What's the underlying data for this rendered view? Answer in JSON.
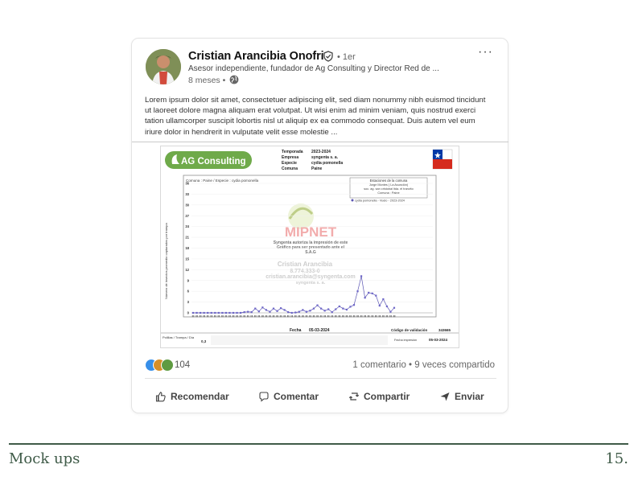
{
  "post": {
    "author_name": "Cristian Arancibia Onofri",
    "connection_degree": "• 1er",
    "headline": "Asesor independiente, fundador de Ag Consulting y Director Red de ...",
    "time": "8 meses •",
    "more_label": "···",
    "text": "Lorem ipsum dolor sit amet, consectetuer adipiscing elit, sed diam nonummy nibh euismod tincidunt ut laoreet dolore magna aliquam erat volutpat. Ut wisi enim ad minim veniam, quis nostrud exerci tation ullamcorper suscipit lobortis nisl ut aliquip ex ea commodo consequat. Duis autem vel eum iriure dolor in hendrerit in vulputate velit esse molestie ...",
    "reactions_count": "104",
    "stats": "1 comentario • 9 veces compartido",
    "actions": {
      "recommend": "Recomendar",
      "comment": "Comentar",
      "share": "Compartir",
      "send": "Enviar"
    }
  },
  "image": {
    "logo": "AG Consulting",
    "meta": {
      "season_label": "Temporada",
      "season": "2023-2024",
      "company_label": "Empresa",
      "company": "syngenta s. a.",
      "species_label": "Especie",
      "species": "cydia pomonella",
      "commune_label": "Comuna",
      "commune": "Paine"
    },
    "chart_subtitle": "Comuna : Paine / Especie : cydia pomonella",
    "legend_title": "Estaciones de la comuna",
    "legend_lines": [
      "Jorge Montes ( La Asunción)",
      "soc. ag. san cristobal ltda. el tranvito",
      "Comuna : Paine"
    ],
    "legend_series": "cydia pomonella - Vuelo - 2023-2024",
    "watermark_brand": "MIPNET",
    "watermark_lines": [
      "Syngenta autoriza la impresión de este",
      "Gráfico para ser presentado ante el",
      "S.A.G"
    ],
    "watermark_person": [
      "Cristian Arancibia",
      "8.774.333-0",
      "cristian.arancibia@syngenta.com",
      "syngenta s. a."
    ],
    "fecha_label": "Fecha",
    "fecha": "05-03-2024",
    "validation_label": "Código de validación",
    "validation_code": "343665",
    "print_label": "Fecha impresión",
    "print_date": "05-03-2024",
    "bottom_left": "Polillas / Trampa / Día",
    "bottom_left_value": "0,3"
  },
  "chart_data": {
    "type": "line",
    "ylabel": "Número de insectos promedio capturados por trampa",
    "ylim": [
      0,
      36
    ],
    "yticks": [
      0,
      3,
      6,
      9,
      12,
      15,
      18,
      21,
      24,
      27,
      30,
      33,
      36
    ],
    "series": [
      {
        "name": "cydia pomonella - Vuelo - 2023-2024",
        "values": [
          0,
          0,
          0,
          0,
          0,
          0,
          0,
          0,
          0,
          0,
          0,
          0,
          0,
          0,
          0.2,
          0.3,
          0.2,
          1.2,
          0.4,
          1.5,
          0.8,
          0.3,
          1.2,
          0.5,
          1.3,
          0.8,
          0.2,
          0,
          0.1,
          0.3,
          0.8,
          0.3,
          0.6,
          1.2,
          2.1,
          1.2,
          0.6,
          1.0,
          0.2,
          1.0,
          1.8,
          1.2,
          0.9,
          1.7,
          2.2,
          6.0,
          10.2,
          4.2,
          5.6,
          5.4,
          4.8,
          2.0,
          3.8,
          1.8,
          0.3,
          1.4
        ]
      }
    ],
    "colors": {
      "line": "#5b55b3",
      "marker": "#6d66c7"
    }
  },
  "footer": {
    "left": "Mock ups",
    "right": "15."
  },
  "colors": {
    "accent": "#3f5b48",
    "ag_green": "#6faa4a",
    "chile_red": "#d52b1e",
    "chile_blue": "#0039a6"
  }
}
